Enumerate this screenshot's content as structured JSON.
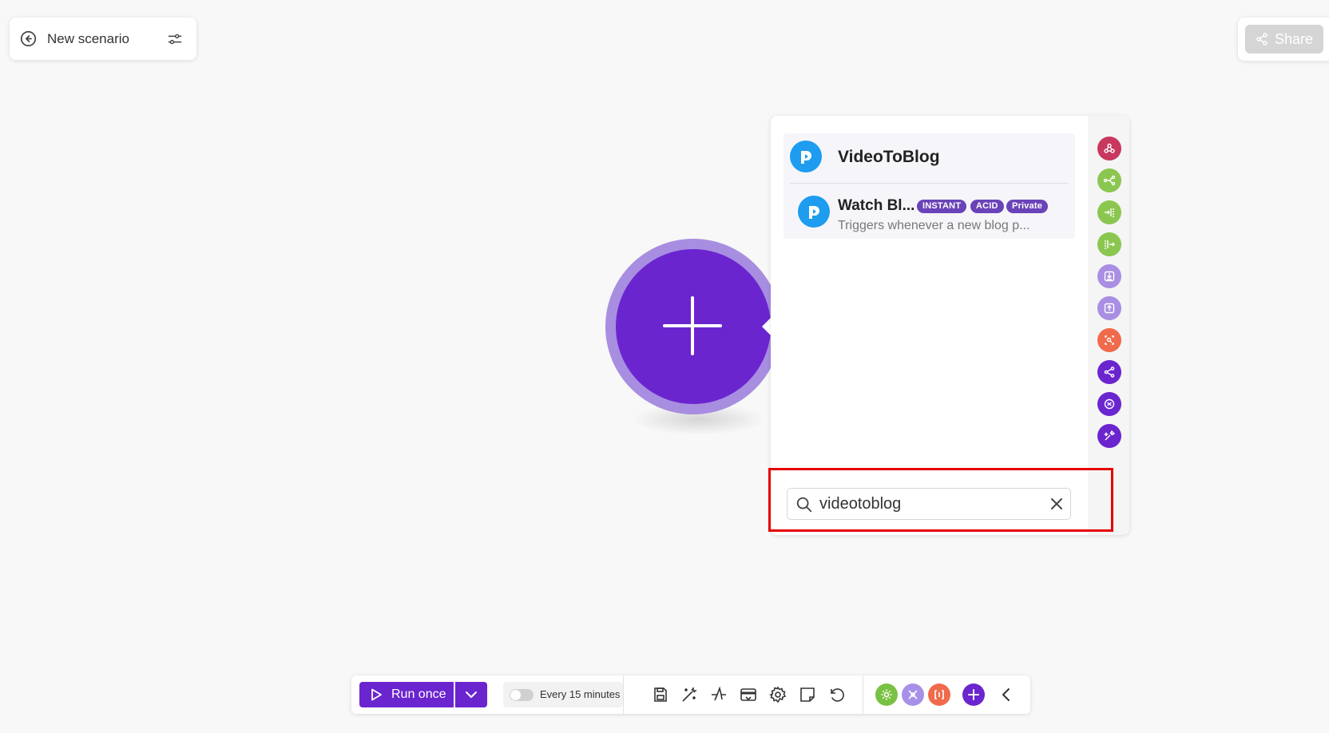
{
  "header": {
    "scenario_name": "New scenario"
  },
  "share": {
    "label": "Share"
  },
  "results": {
    "app_title": "VideoToBlog",
    "module": {
      "name": "Watch Bl...",
      "badges": [
        "INSTANT",
        "ACID",
        "Private"
      ],
      "description": "Triggers whenever a new blog p..."
    }
  },
  "search": {
    "value": "videotoblog"
  },
  "toolbar": {
    "run_label": "Run once",
    "schedule_label": "Every 15 minutes"
  },
  "colors": {
    "brand_purple": "#6b25cf",
    "ring_purple": "#a88ee0",
    "app_blue": "#1e9cf0",
    "badge_purple": "#6a43b8",
    "highlight_red": "#e60000",
    "rail_red": "#c8385e",
    "rail_green": "#8bc750",
    "rail_lavender": "#a98fe3",
    "rail_orange": "#f06a4c",
    "tools_green": "#79c143",
    "tools_lavender": "#a690e8",
    "tools_orange": "#f06a4c"
  },
  "rail_icons": [
    "webhooks-icon",
    "router-icon",
    "aggregator-icon",
    "iterator-icon",
    "data-store-in-icon",
    "data-store-out-icon",
    "search-text-icon",
    "flow-control-icon",
    "text-parser-icon",
    "tools-icon"
  ],
  "toolbar_icons": [
    "save-icon",
    "auto-align-icon",
    "explain-flow-icon",
    "notes-icon",
    "settings-icon",
    "sticky-note-icon",
    "undo-icon",
    "tools-green-icon",
    "tools-flow-icon",
    "text-parser-icon",
    "add-module-icon",
    "collapse-icon"
  ]
}
